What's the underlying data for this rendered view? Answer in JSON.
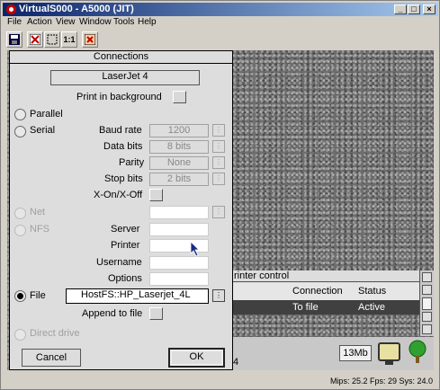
{
  "window": {
    "title": "VirtualS000 - A5000 (JIT)",
    "min_glyph": "_",
    "max_glyph": "□",
    "close_glyph": "×"
  },
  "menu": [
    "File",
    "Action",
    "View",
    "Window",
    "Tools",
    "Help"
  ],
  "toolbar": {
    "save_icon": "floppy-icon",
    "buttons": [
      "save",
      "fullscreen-off",
      "zoom-fit",
      "1:1",
      "reset"
    ],
    "one_to_one_label": "1:1"
  },
  "status": {
    "text": "Mips: 25.2 Fps: 29  Sys: 24.0"
  },
  "dialog": {
    "title": "Connections",
    "printer_name": "LaserJet 4",
    "print_background_label": "Print in background",
    "parallel_label": "Parallel",
    "serial_label": "Serial",
    "baud_rate_label": "Baud rate",
    "baud_rate_value": "1200",
    "data_bits_label": "Data bits",
    "data_bits_value": "8 bits",
    "parity_label": "Parity",
    "parity_value": "None",
    "stop_bits_label": "Stop bits",
    "stop_bits_value": "2 bits",
    "xon_label": "X-On/X-Off",
    "net_label": "Net",
    "nfs_label": "NFS",
    "server_label": "Server",
    "printer_label": "Printer",
    "username_label": "Username",
    "options_label": "Options",
    "file_label": "File",
    "file_value": "HostFS::HP_Laserjet_4L",
    "append_label": "Append to file",
    "direct_label": "Direct drive",
    "cancel_label": "Cancel",
    "ok_label": "OK",
    "popup_glyph": "⋮"
  },
  "printer_control": {
    "title": "rinter control",
    "col_connection": "Connection",
    "col_status": "Status",
    "row_connection": "To file",
    "row_status": "Active"
  },
  "iconbar": {
    "stray_char": "4",
    "memory": "13Mb"
  },
  "colors": {
    "title_start": "#0a246a",
    "title_end": "#a6caf0",
    "dialog_bg": "#dddddd",
    "selected_row": "#404040"
  }
}
